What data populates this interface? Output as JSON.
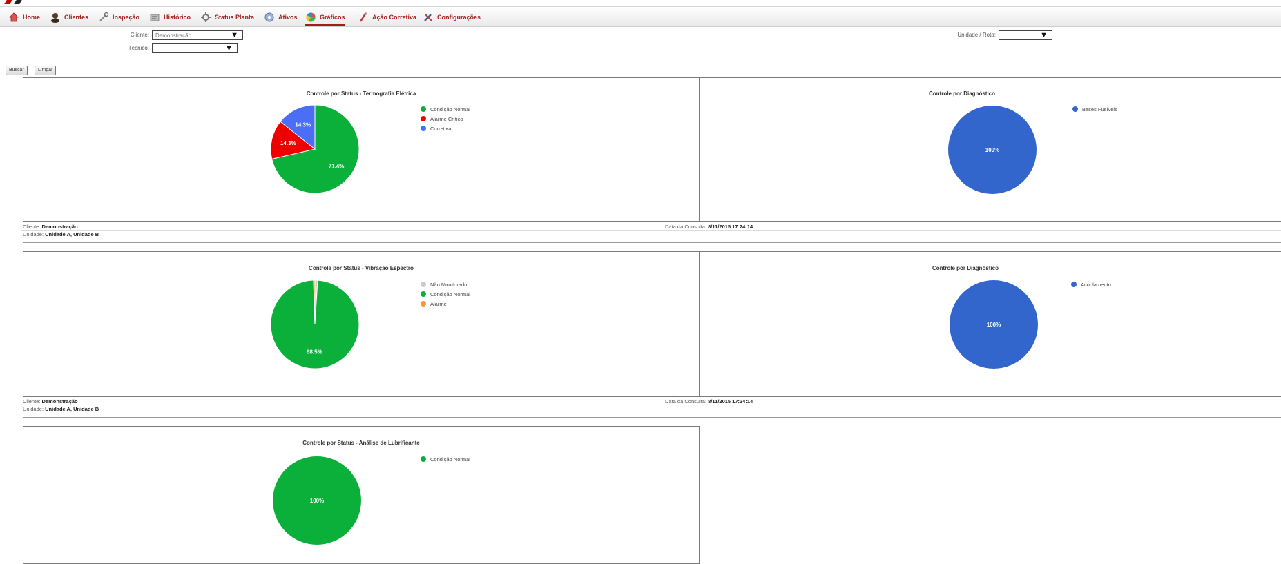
{
  "nav": {
    "items": [
      {
        "label": "Home",
        "icon": "home-icon"
      },
      {
        "label": "Clientes",
        "icon": "clients-icon"
      },
      {
        "label": "Inspeção",
        "icon": "inspection-icon"
      },
      {
        "label": "Histórico",
        "icon": "history-icon"
      },
      {
        "label": "Status Planta",
        "icon": "plant-status-icon"
      },
      {
        "label": "Ativos",
        "icon": "assets-icon"
      },
      {
        "label": "Gráficos",
        "icon": "charts-icon"
      },
      {
        "label": "Ação Corretiva",
        "icon": "corrective-action-icon"
      },
      {
        "label": "Configurações",
        "icon": "settings-icon"
      }
    ],
    "active": "Gráficos"
  },
  "filters": {
    "cliente_label": "Cliente:",
    "cliente_value": "Demonstração",
    "tecnico_label": "Técnico:",
    "tecnico_value": "",
    "unidade_label": "Unidade / Rota:",
    "unidade_value": ""
  },
  "buttons": {
    "buscar": "Buscar",
    "limpar": "Limpar"
  },
  "info": {
    "cliente_label": "Cliente:",
    "cliente_value": "Demonstração",
    "unidade_label": "Unidade:",
    "unidade_value": "Unidade A, Unidade B",
    "data_label": "Data da Consulta:",
    "data_value": "8/11/2015 17:24:14"
  },
  "colors": {
    "normal": "#0bb03a",
    "critico": "#ee0000",
    "corretiva": "#4a6ef5",
    "nao_monitorado": "#cccccc",
    "alarme": "#f4992e",
    "diag": "#3366cc",
    "nav_text": "#a21d1d"
  },
  "chart_data": [
    {
      "type": "pie",
      "title": "Controle por Status - Termografia Elétrica",
      "labels": [
        "Condição Normal",
        "Alarme Crítico",
        "Corretiva"
      ],
      "values": [
        71.4,
        14.3,
        14.3
      ],
      "value_labels": [
        "71.4%",
        "14.3%",
        "14.3%"
      ],
      "colors": [
        "#0bb03a",
        "#ee0000",
        "#4a6ef5"
      ],
      "legend": "right"
    },
    {
      "type": "pie",
      "title": "Controle por Diagnóstico",
      "labels": [
        "Bases Fusíveis"
      ],
      "values": [
        100
      ],
      "value_labels": [
        "100%"
      ],
      "colors": [
        "#3366cc"
      ],
      "legend": "right"
    },
    {
      "type": "pie",
      "title": "Controle por Status - Vibração Espectro",
      "labels": [
        "Não Monitorado",
        "Condição Normal",
        "Alarme"
      ],
      "values": [
        1.0,
        98.5,
        0.5
      ],
      "value_labels": [
        "",
        "98.5%",
        ""
      ],
      "colors": [
        "#cccccc",
        "#0bb03a",
        "#f4992e"
      ],
      "legend": "right"
    },
    {
      "type": "pie",
      "title": "Controle por Diagnóstico",
      "labels": [
        "Acoplamento"
      ],
      "values": [
        100
      ],
      "value_labels": [
        "100%"
      ],
      "colors": [
        "#3366cc"
      ],
      "legend": "right"
    },
    {
      "type": "pie",
      "title": "Controle por Status - Análise de Lubrificante",
      "labels": [
        "Condição Normal"
      ],
      "values": [
        100
      ],
      "value_labels": [
        "100%"
      ],
      "colors": [
        "#0bb03a"
      ],
      "legend": "right"
    }
  ]
}
